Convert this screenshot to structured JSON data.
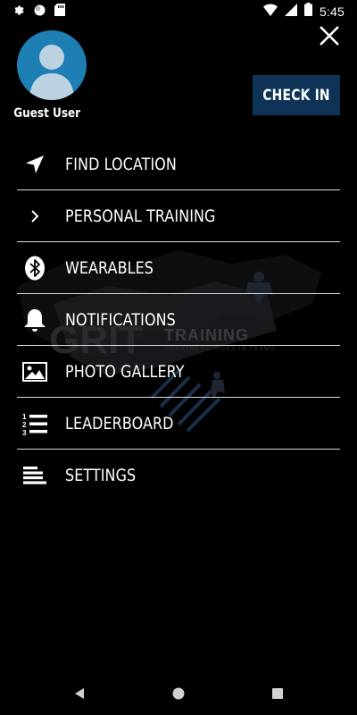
{
  "status_bar": {
    "time": "5:45",
    "left_icons": [
      "gear-icon",
      "circle-icon",
      "sd-card-icon"
    ],
    "right_icons": [
      "wifi-icon",
      "signal-icon",
      "battery-icon"
    ]
  },
  "header": {
    "user_name": "Guest User",
    "check_in_label": "CHECK IN",
    "accent_color": "#0e3356",
    "avatar_color": "#1d7fb3"
  },
  "menu": {
    "items": [
      {
        "label": "FIND LOCATION",
        "icon": "navigation-arrow-icon"
      },
      {
        "label": "PERSONAL TRAINING",
        "icon": "chevron-right-icon"
      },
      {
        "label": "WEARABLES",
        "icon": "bluetooth-icon"
      },
      {
        "label": "NOTIFICATIONS",
        "icon": "bell-icon"
      },
      {
        "label": "PHOTO GALLERY",
        "icon": "image-icon"
      },
      {
        "label": "LEADERBOARD",
        "icon": "numbered-list-icon"
      },
      {
        "label": "SETTINGS",
        "icon": "align-left-icon"
      }
    ]
  },
  "background_art": {
    "brand": "GRIT",
    "word": "TRAINING",
    "tagline": "GREATNESS RISES IN TEAMS"
  }
}
